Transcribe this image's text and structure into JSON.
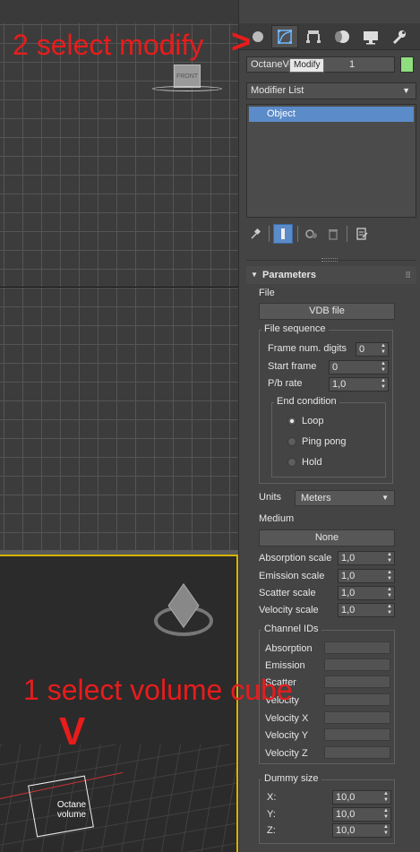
{
  "annotations": {
    "step2": "2 select modify",
    "step2_arrow": ">",
    "step1": "1 select volume cube",
    "step1_arrow": "V"
  },
  "viewports": {
    "top": {
      "viewcube_label": "FRONT"
    },
    "perspective": {
      "object_label_line1": "Octane",
      "object_label_line2": "volume"
    }
  },
  "command_panel": {
    "tabs": [
      {
        "name": "create-icon",
        "active": false
      },
      {
        "name": "modify-icon",
        "active": true
      },
      {
        "name": "hierarchy-icon",
        "active": false
      },
      {
        "name": "motion-icon",
        "active": false
      },
      {
        "name": "display-icon",
        "active": false
      },
      {
        "name": "utilities-icon",
        "active": false
      }
    ],
    "object_name": "OctaneVo",
    "object_name_suffix": "1",
    "object_color": "#8ede7e",
    "tooltip": "Modify",
    "modifier_list_label": "Modifier List",
    "stack_items": [
      "Object"
    ],
    "accent_color": "#5b8bc9"
  },
  "parameters": {
    "rollout_title": "Parameters",
    "file_label": "File",
    "file_button": "VDB file",
    "file_sequence": {
      "title": "File sequence",
      "frame_digits_label": "Frame num. digits",
      "frame_digits_value": "0",
      "start_frame_label": "Start frame",
      "start_frame_value": "0",
      "pb_rate_label": "P/b rate",
      "pb_rate_value": "1,0",
      "end_condition": {
        "title": "End condition",
        "options": [
          "Loop",
          "Ping pong",
          "Hold"
        ],
        "selected": "Loop"
      }
    },
    "units_label": "Units",
    "units_value": "Meters",
    "medium_label": "Medium",
    "medium_button": "None",
    "scales": [
      {
        "label": "Absorption scale",
        "value": "1,0"
      },
      {
        "label": "Emission scale",
        "value": "1,0"
      },
      {
        "label": "Scatter scale",
        "value": "1,0"
      },
      {
        "label": "Velocity scale",
        "value": "1,0"
      }
    ],
    "channel_ids": {
      "title": "Channel IDs",
      "items": [
        "Absorption",
        "Emission",
        "Scatter",
        "Velocity",
        "Velocity X",
        "Velocity Y",
        "Velocity Z"
      ]
    },
    "dummy_size": {
      "title": "Dummy size",
      "items": [
        {
          "label": "X:",
          "value": "10,0"
        },
        {
          "label": "Y:",
          "value": "10,0"
        },
        {
          "label": "Z:",
          "value": "10,0"
        }
      ]
    }
  }
}
